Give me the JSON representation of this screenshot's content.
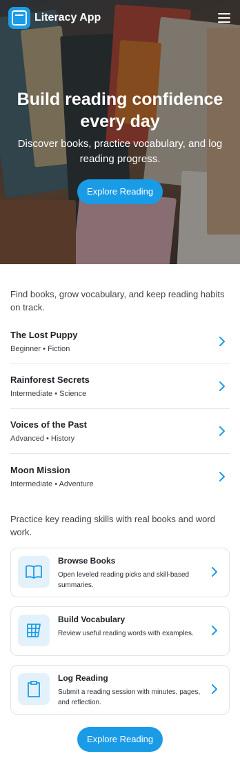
{
  "header": {
    "app_title": "Literacy App"
  },
  "hero": {
    "title": "Build reading confidence every day",
    "subtitle": "Discover books, practice vocabulary, and log reading progress.",
    "cta_label": "Explore Reading"
  },
  "books_section": {
    "intro": "Find books, grow vocabulary, and keep reading habits on track.",
    "items": [
      {
        "title": "The Lost Puppy",
        "meta": "Beginner • Fiction"
      },
      {
        "title": "Rainforest Secrets",
        "meta": "Intermediate • Science"
      },
      {
        "title": "Voices of the Past",
        "meta": "Advanced • History"
      },
      {
        "title": "Moon Mission",
        "meta": "Intermediate • Adventure"
      }
    ]
  },
  "skills_section": {
    "intro": "Practice key reading skills with real books and word work.",
    "cards": [
      {
        "icon": "book-open-icon",
        "title": "Browse Books",
        "desc": "Open leveled reading picks and skill-based summaries."
      },
      {
        "icon": "vocabulary-grid-icon",
        "title": "Build Vocabulary",
        "desc": "Review useful reading words with examples."
      },
      {
        "icon": "clipboard-icon",
        "title": "Log Reading",
        "desc": "Submit a reading session with minutes, pages, and reflection."
      }
    ]
  },
  "bottom_cta_label": "Explore Reading",
  "colors": {
    "accent": "#1a9be6",
    "icon_bg": "#e3f1fb"
  }
}
